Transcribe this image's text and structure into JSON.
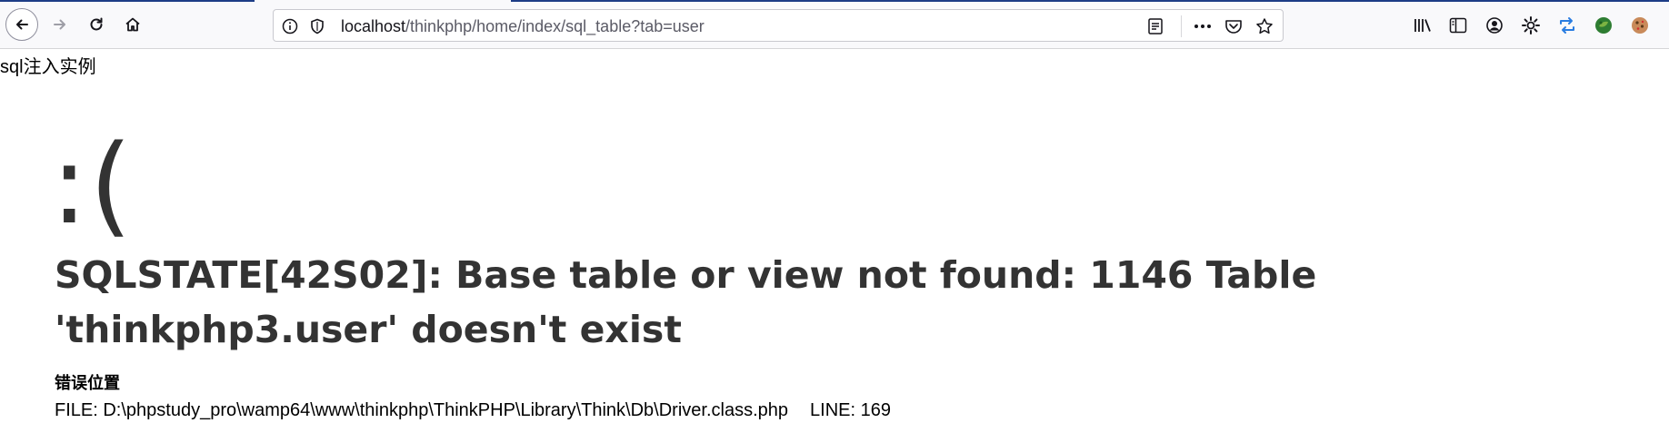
{
  "browser": {
    "url_host": "localhost",
    "url_path": "/thinkphp/home/index/sql_table?tab=user",
    "icons": {
      "back": "arrow-left-icon",
      "forward": "arrow-right-icon",
      "reload": "reload-icon",
      "home": "home-icon",
      "tracking": "shield-icon",
      "info": "info-icon",
      "reader": "reader-view-icon",
      "more": "more-icon",
      "pocket": "pocket-icon",
      "bookmark": "star-icon",
      "library": "library-icon",
      "sidebar": "sidebar-icon",
      "account": "account-icon",
      "settings": "gear-icon",
      "sync": "sync-icon",
      "extension1": "extension-green-icon",
      "extension2": "cookie-icon"
    },
    "accent": "#1d3d86"
  },
  "page": {
    "heading": "sql注入实例",
    "face": ":(",
    "error_message": "SQLSTATE[42S02]: Base table or view not found: 1146 Table 'thinkphp3.user' doesn't exist",
    "error_location_title": "错误位置",
    "file_label": "FILE: D:\\phpstudy_pro\\wamp64\\www\\thinkphp\\ThinkPHP\\Library\\Think\\Db\\Driver.class.php",
    "line_label": "LINE: 169"
  }
}
